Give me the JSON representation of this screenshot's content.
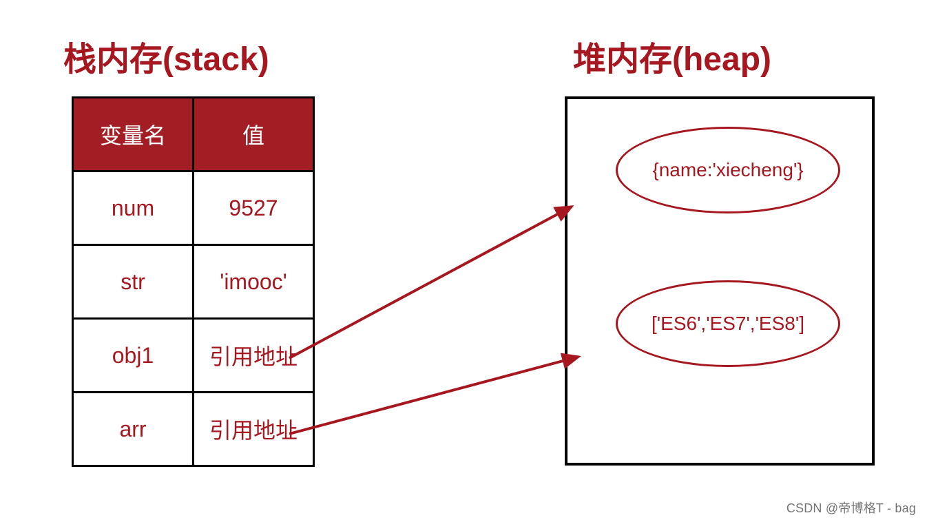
{
  "titles": {
    "stack": "栈内存(stack)",
    "heap": "堆内存(heap)"
  },
  "table": {
    "headers": {
      "name": "变量名",
      "value": "值"
    },
    "rows": [
      {
        "name": "num",
        "value": "9527"
      },
      {
        "name": "str",
        "value": "'imooc'"
      },
      {
        "name": "obj1",
        "value": "引用地址"
      },
      {
        "name": "arr",
        "value": "引用地址"
      }
    ]
  },
  "heap": {
    "obj": "{name:'xiecheng'}",
    "arr": "['ES6','ES7','ES8']"
  },
  "colors": {
    "accent": "#a6171f",
    "header_bg": "#a21e24",
    "border": "#000000"
  },
  "watermark": "CSDN @帝博格T - bag"
}
